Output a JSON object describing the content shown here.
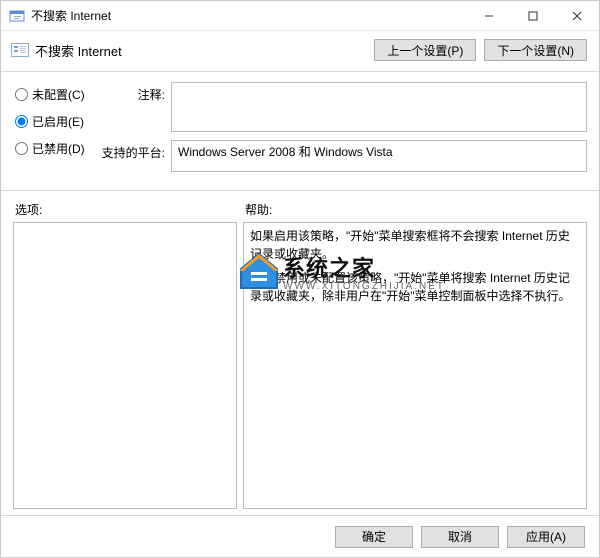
{
  "window": {
    "title": "不搜索 Internet",
    "header_title": "不搜索 Internet"
  },
  "nav": {
    "prev": "上一个设置(P)",
    "next": "下一个设置(N)"
  },
  "radios": {
    "not_configured": "未配置(C)",
    "enabled": "已启用(E)",
    "disabled": "已禁用(D)"
  },
  "fields": {
    "comment_label": "注释:",
    "comment_value": "",
    "platform_label": "支持的平台:",
    "platform_value": "Windows Server 2008 和 Windows Vista"
  },
  "sections": {
    "options_label": "选项:",
    "help_label": "帮助:"
  },
  "help": {
    "p1": "如果启用该策略，\"开始\"菜单搜索框将不会搜索 Internet 历史记录或收藏夹。",
    "p2": "如果禁用或未配置该策略，\"开始\"菜单将搜索 Internet 历史记录或收藏夹，除非用户在\"开始\"菜单控制面板中选择不执行。"
  },
  "footer": {
    "ok": "确定",
    "cancel": "取消",
    "apply": "应用(A)"
  },
  "watermark": {
    "brand": "系统之家",
    "url": "WWW.XITONGZHIJIA.NET"
  }
}
